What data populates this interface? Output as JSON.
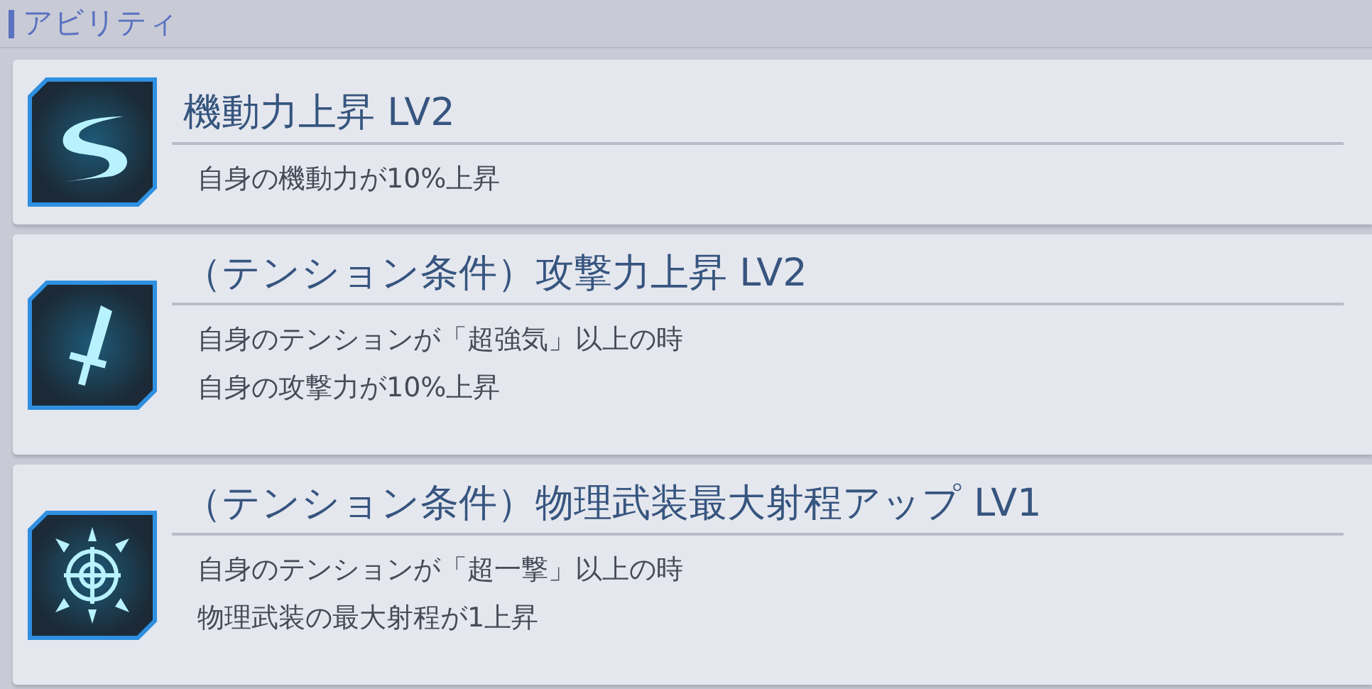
{
  "section": {
    "title": "アビリティ"
  },
  "abilities": [
    {
      "kind": "swirl",
      "name": "機動力上昇 LV2",
      "description": [
        "自身の機動力が10%上昇"
      ]
    },
    {
      "kind": "sword",
      "name": "（テンション条件）攻撃力上昇 LV2",
      "description": [
        "自身のテンションが「超強気」以上の時",
        "自身の攻撃力が10%上昇"
      ]
    },
    {
      "kind": "target",
      "name": "（テンション条件）物理武装最大射程アップ LV1",
      "description": [
        "自身のテンションが「超一撃」以上の時",
        "物理武装の最大射程が1上昇"
      ]
    }
  ]
}
